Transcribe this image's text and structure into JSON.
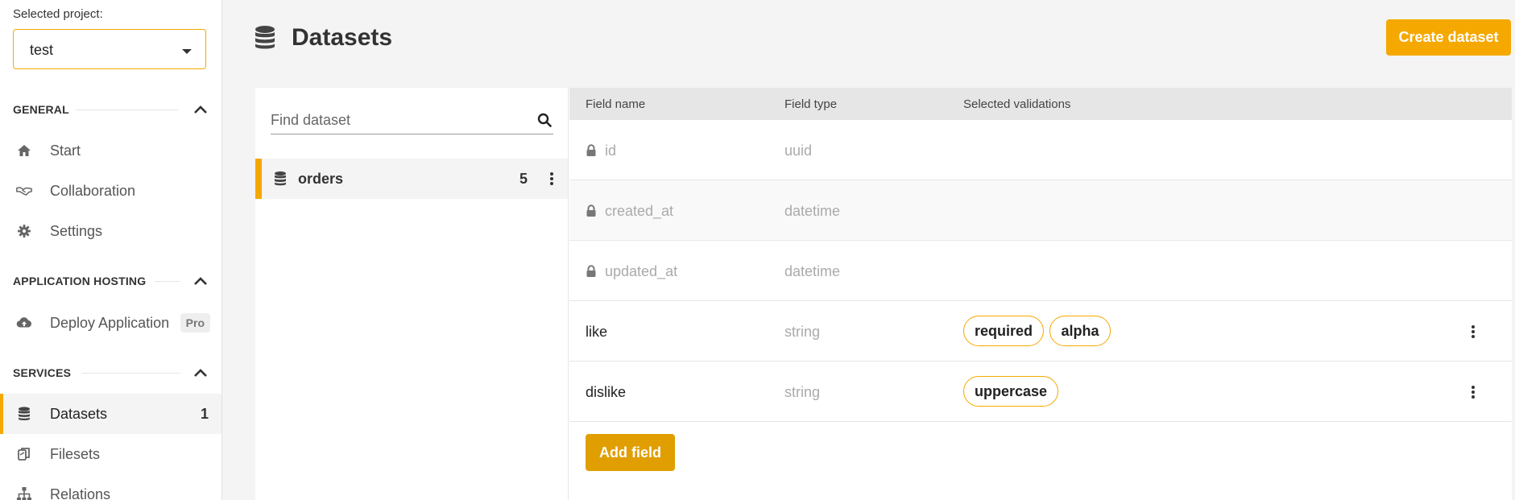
{
  "sidebar": {
    "project_label": "Selected project:",
    "project_value": "test",
    "sections": {
      "general": {
        "title": "GENERAL",
        "items": [
          {
            "label": "Start",
            "icon": "home-icon"
          },
          {
            "label": "Collaboration",
            "icon": "handshake-icon"
          },
          {
            "label": "Settings",
            "icon": "gear-icon"
          }
        ]
      },
      "hosting": {
        "title": "APPLICATION HOSTING",
        "items": [
          {
            "label": "Deploy Application",
            "icon": "cloud-upload-icon",
            "badge": "Pro"
          }
        ]
      },
      "services": {
        "title": "SERVICES",
        "items": [
          {
            "label": "Datasets",
            "icon": "database-icon",
            "count": "1",
            "active": true
          },
          {
            "label": "Filesets",
            "icon": "files-icon"
          },
          {
            "label": "Relations",
            "icon": "sitemap-icon"
          }
        ]
      }
    }
  },
  "main": {
    "title": "Datasets",
    "create_button": "Create dataset",
    "search_placeholder": "Find dataset",
    "datasets": [
      {
        "name": "orders",
        "count": "5"
      }
    ],
    "fields_header": {
      "name": "Field name",
      "type": "Field type",
      "validations": "Selected validations"
    },
    "fields": [
      {
        "name": "id",
        "type": "uuid",
        "locked": true,
        "validations": []
      },
      {
        "name": "created_at",
        "type": "datetime",
        "locked": true,
        "validations": []
      },
      {
        "name": "updated_at",
        "type": "datetime",
        "locked": true,
        "validations": []
      },
      {
        "name": "like",
        "type": "string",
        "locked": false,
        "validations": [
          "required",
          "alpha"
        ]
      },
      {
        "name": "dislike",
        "type": "string",
        "locked": false,
        "validations": [
          "uppercase"
        ]
      }
    ],
    "add_field_button": "Add field"
  },
  "colors": {
    "accent": "#f5a800",
    "accent_dark": "#e09e00",
    "background": "#f4f4f4"
  }
}
